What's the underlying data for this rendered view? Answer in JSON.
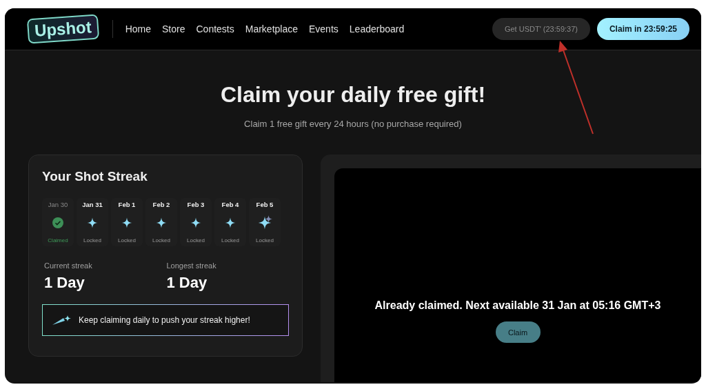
{
  "header": {
    "logo": "Upshot",
    "nav": [
      {
        "label": "Home"
      },
      {
        "label": "Store"
      },
      {
        "label": "Contests"
      },
      {
        "label": "Marketplace"
      },
      {
        "label": "Events"
      },
      {
        "label": "Leaderboard"
      }
    ],
    "usdt_button": "Get USDT' (23:59:37)",
    "claim_button": "Claim in 23:59:25"
  },
  "hero": {
    "title": "Claim your daily free gift!",
    "subtitle": "Claim 1 free gift every 24 hours (no purchase required)"
  },
  "streak": {
    "title": "Your Shot Streak",
    "days": [
      {
        "date": "Jan 30",
        "status": "Claimed",
        "kind": "claimed"
      },
      {
        "date": "Jan 31",
        "status": "Locked",
        "kind": "locked"
      },
      {
        "date": "Feb 1",
        "status": "Locked",
        "kind": "locked"
      },
      {
        "date": "Feb 2",
        "status": "Locked",
        "kind": "locked"
      },
      {
        "date": "Feb 3",
        "status": "Locked",
        "kind": "locked"
      },
      {
        "date": "Feb 4",
        "status": "Locked",
        "kind": "locked"
      },
      {
        "date": "Feb 5",
        "status": "Locked",
        "kind": "bonus"
      }
    ],
    "stats": [
      {
        "label": "Current streak",
        "value": "1 Day"
      },
      {
        "label": "Longest streak",
        "value": "1 Day"
      }
    ],
    "tip": "Keep claiming daily to push your streak higher!"
  },
  "gift_panel": {
    "message": "Already claimed. Next available 31 Jan at 05:16 GMT+3",
    "claim_button": {
      "label": "Claim",
      "disabled": true
    }
  }
}
